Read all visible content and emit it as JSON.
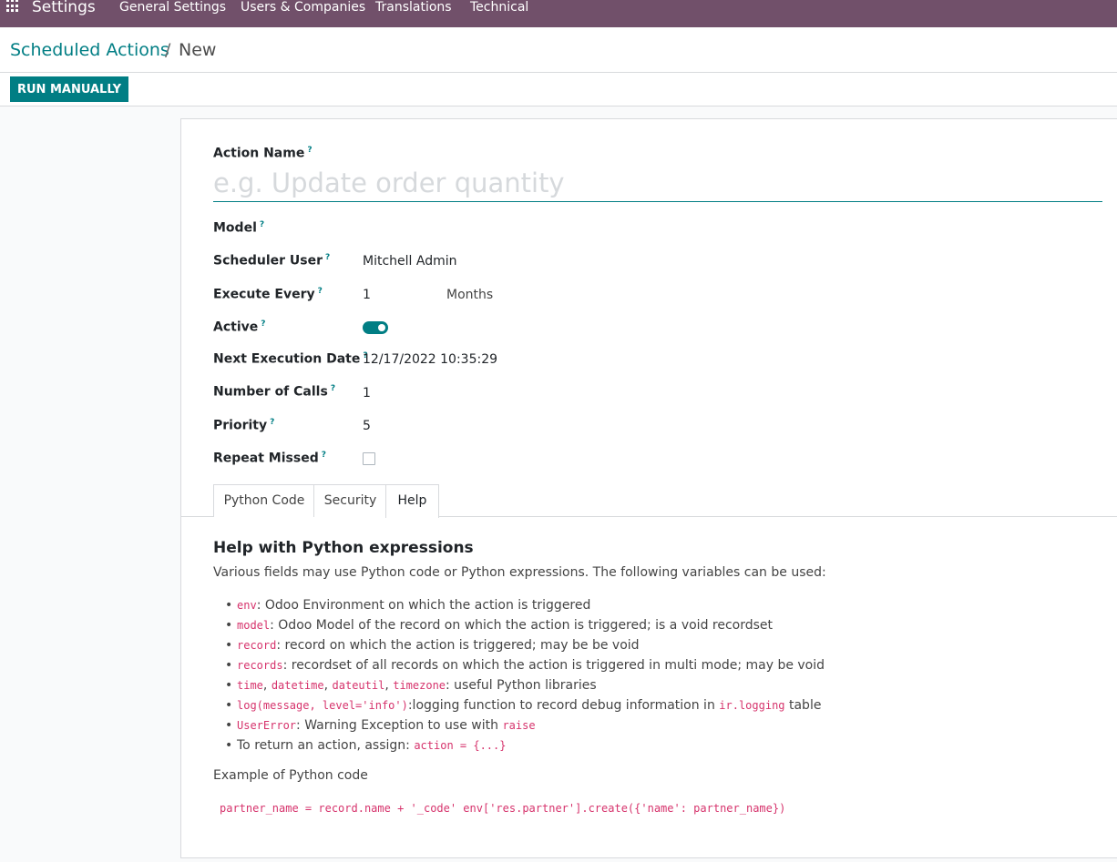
{
  "navbar": {
    "app_title": "Settings",
    "menu": [
      "General Settings",
      "Users & Companies",
      "Translations",
      "Technical"
    ]
  },
  "breadcrumb": {
    "parent": "Scheduled Actions",
    "separator": "/",
    "current": "New"
  },
  "controls": {
    "run_button": "RUN MANUALLY"
  },
  "form": {
    "action_name_label": "Action Name",
    "action_name_placeholder": "e.g. Update order quantity",
    "help_mark": "?",
    "fields": {
      "model": {
        "label": "Model",
        "value": ""
      },
      "scheduler_user": {
        "label": "Scheduler User",
        "value": "Mitchell Admin"
      },
      "execute_every": {
        "label": "Execute Every",
        "value": "1",
        "unit": "Months"
      },
      "active": {
        "label": "Active",
        "value": true
      },
      "next_execution_date": {
        "label": "Next Execution Date",
        "value": "12/17/2022 10:35:29"
      },
      "number_of_calls": {
        "label": "Number of Calls",
        "value": "1"
      },
      "priority": {
        "label": "Priority",
        "value": "5"
      },
      "repeat_missed": {
        "label": "Repeat Missed",
        "value": false
      }
    }
  },
  "tabs": {
    "python_code": "Python Code",
    "security": "Security",
    "help": "Help",
    "active": "Help"
  },
  "help": {
    "title": "Help with Python expressions",
    "intro": "Various fields may use Python code or Python expressions. The following variables can be used:",
    "items": {
      "env_code": "env",
      "env_text": ": Odoo Environment on which the action is triggered",
      "model_code": "model",
      "model_text": ": Odoo Model of the record on which the action is triggered; is a void recordset",
      "record_code": "record",
      "record_text": ": record on which the action is triggered; may be be void",
      "records_code": "records",
      "records_text": ": recordset of all records on which the action is triggered in multi mode; may be void",
      "time_code": "time",
      "comma": ",",
      "datetime_code": "datetime",
      "dateutil_code": "dateutil",
      "timezone_code": "timezone",
      "libs_text": ": useful Python libraries",
      "log_code": "log(message, level='info')",
      "log_text": ":logging function to record debug information in",
      "log_table_code": "ir.logging",
      "log_table_text": "table",
      "usererror_code": "UserError",
      "usererror_text": ": Warning Exception to use with",
      "raise_code": "raise",
      "return_text": "To return an action, assign:",
      "return_code": "action = {...}"
    },
    "example_label": "Example of Python code",
    "example_code": "partner_name = record.name + '_code' env['res.partner'].create({'name': partner_name})"
  }
}
